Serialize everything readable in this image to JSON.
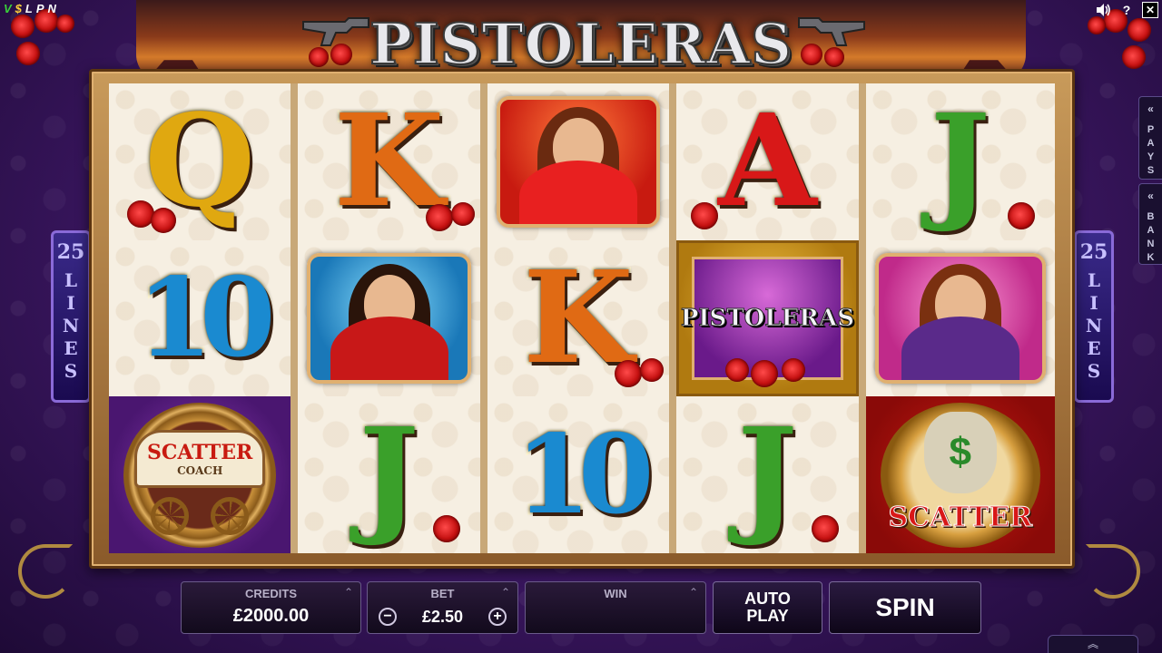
{
  "brand_badge": [
    "V",
    "$",
    "L",
    "P",
    "N"
  ],
  "title": "PISTOLERAS",
  "topbar": {
    "sound_icon": "speaker-icon",
    "help_label": "?",
    "close_label": "✕"
  },
  "lines_indicator": {
    "count": "25",
    "word": [
      "L",
      "I",
      "N",
      "E",
      "S"
    ]
  },
  "side_tabs": {
    "pays": [
      "P",
      "A",
      "Y",
      "S"
    ],
    "bank": [
      "B",
      "A",
      "N",
      "K"
    ]
  },
  "reels": [
    [
      "Q",
      "10",
      "scatter-coach"
    ],
    [
      "K",
      "pistolera-blue",
      "J"
    ],
    [
      "pistolera-red",
      "K",
      "10"
    ],
    [
      "A",
      "wild",
      "J"
    ],
    [
      "J",
      "pistolera-pink",
      "scatter-money"
    ]
  ],
  "symbols": {
    "wild_text": "PISTOLERAS",
    "coach_text": "SCATTER",
    "coach_sub": "COACH",
    "money_text": "SCATTER",
    "money_sign": "$"
  },
  "controls": {
    "credits_label": "CREDITS",
    "credits_value": "£2000.00",
    "bet_label": "BET",
    "bet_value": "£2.50",
    "bet_minus": "−",
    "bet_plus": "+",
    "win_label": "WIN",
    "win_value": "",
    "autoplay_line1": "AUTO",
    "autoplay_line2": "PLAY",
    "spin_label": "SPIN"
  },
  "colors": {
    "background": "#3a1660",
    "reel_bg": "#f6efe2",
    "frame": "#c89a5a"
  }
}
